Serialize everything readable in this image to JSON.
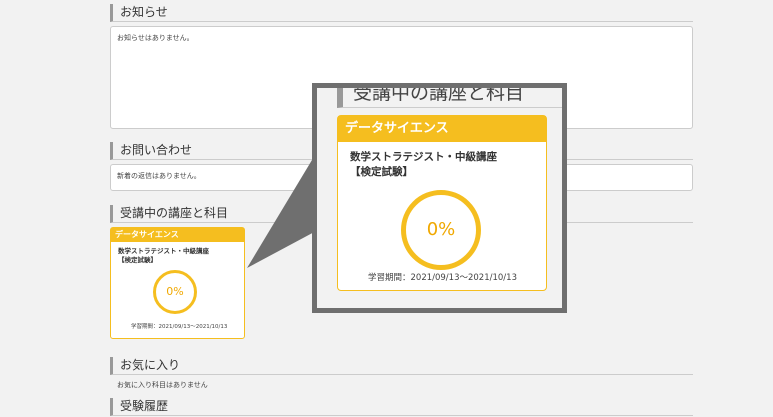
{
  "sections": {
    "notices": {
      "title": "お知らせ",
      "body": "お知らせはありません。"
    },
    "inquiries": {
      "title": "お問い合わせ",
      "body": "新着の返信はありません。"
    },
    "courses": {
      "title": "受講中の講座と科目"
    },
    "favorites": {
      "title": "お気に入り",
      "body": "お気に入り科目はありません"
    },
    "history": {
      "title": "受験履歴"
    }
  },
  "course_card": {
    "category": "データサイエンス",
    "name_line1": "数学ストラテジスト・中級講座",
    "name_line2": "【検定試験】",
    "progress": "0%",
    "period": "学習期間：2021/09/13〜2021/10/13"
  },
  "zoom": {
    "title": "受講中の講座と科目"
  },
  "colors": {
    "accent": "#f5be1f",
    "progress_text": "#f0a800",
    "frame": "#6f6f6f"
  }
}
